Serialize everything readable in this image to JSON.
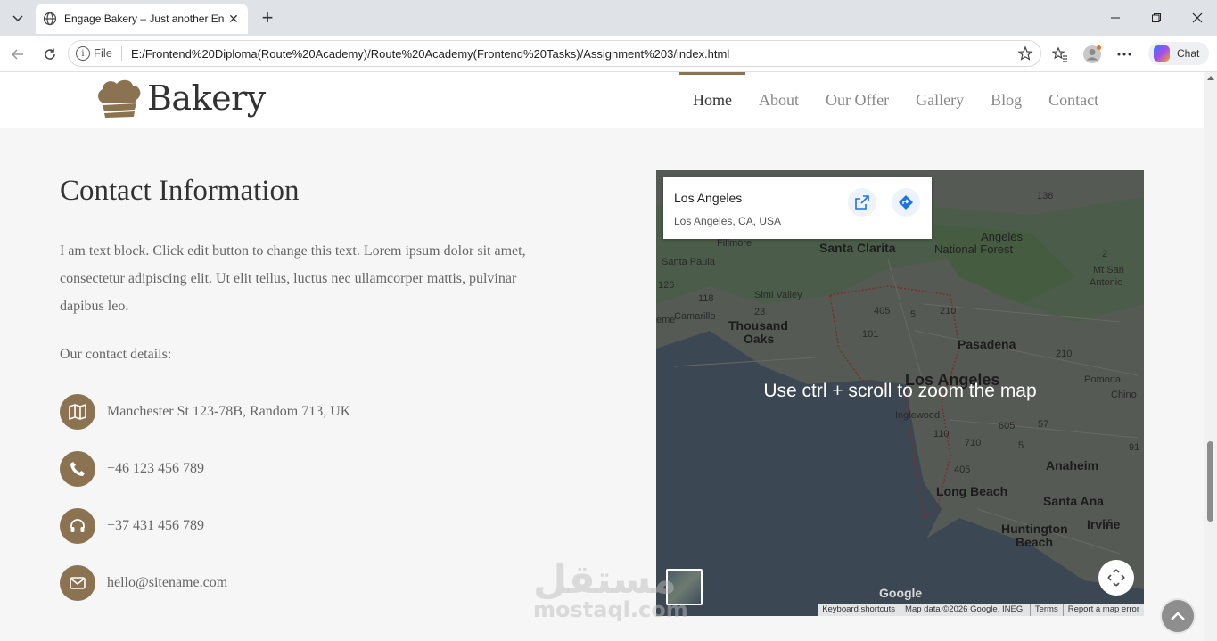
{
  "browser": {
    "tab_title": "Engage Bakery – Just another Engage",
    "url_prefix": "File",
    "url": "E:/Frontend%20Diploma(Route%20Academy)/Route%20Academy(Frontend%20Tasks)/Assignment%203/index.html",
    "chat_label": "Chat"
  },
  "header": {
    "logo_text": "Bakery",
    "nav": [
      {
        "label": "Home",
        "active": true
      },
      {
        "label": "About"
      },
      {
        "label": "Our Offer"
      },
      {
        "label": "Gallery"
      },
      {
        "label": "Blog"
      },
      {
        "label": "Contact"
      }
    ]
  },
  "contact": {
    "title": "Contact Information",
    "lead": "I am text block. Click edit button to change this text. Lorem ipsum dolor sit amet, consectetur adipiscing elit. Ut elit tellus, luctus nec ullamcorper mattis, pulvinar dapibus leo.",
    "details_title": "Our contact details:",
    "items": [
      {
        "icon": "map-icon",
        "text": "Manchester St 123-78B, Random 713, UK"
      },
      {
        "icon": "phone-icon",
        "text": "+46 123 456 789"
      },
      {
        "icon": "headphones-icon",
        "text": "+37 431 456 789"
      },
      {
        "icon": "envelope-icon",
        "text": "hello@sitename.com"
      }
    ]
  },
  "map": {
    "place_name": "Los Angeles",
    "place_address": "Los Angeles, CA, USA",
    "zoom_hint": "Use ctrl + scroll to zoom the map",
    "google": "Google",
    "attribution": [
      "Keyboard shortcuts",
      "Map data ©2026 Google, INEGI",
      "Terms",
      "Report a map error"
    ],
    "labels": {
      "santa_clarita": "Santa Clarita",
      "angeles_forest_1": "Angeles",
      "angeles_forest_2": "National Forest",
      "fillmore": "Fillmore",
      "santa_paula": "Santa Paula",
      "simi_valley": "Simi Valley",
      "camarillo": "Camarillo",
      "thousand_oaks_1": "Thousand",
      "thousand_oaks_2": "Oaks",
      "pasadena": "Pasadena",
      "los_angeles": "Los Angeles",
      "inglewood": "Inglewood",
      "pomona": "Pomona",
      "chino": "Chino",
      "mt_san_antonio_1": "Mt San",
      "mt_san_antonio_2": "Antonio",
      "anaheim": "Anaheim",
      "long_beach": "Long Beach",
      "santa_ana": "Santa Ana",
      "huntington_beach_1": "Huntington",
      "huntington_beach_2": "Beach",
      "irvine": "Irvine",
      "oxnard_partial": "eme",
      "r138": "138",
      "r2": "2",
      "r126": "126",
      "r118": "118",
      "r23": "23",
      "r405": "405",
      "r5": "5",
      "r210": "210",
      "r101": "101",
      "r110": "110",
      "r710": "710",
      "r605": "605",
      "r405b": "405",
      "r5b": "5",
      "r57": "57",
      "r210b": "210",
      "r55": "55",
      "r91": "91"
    }
  },
  "watermark": {
    "arabic": "مستقل",
    "latin": "mostaql.com"
  }
}
